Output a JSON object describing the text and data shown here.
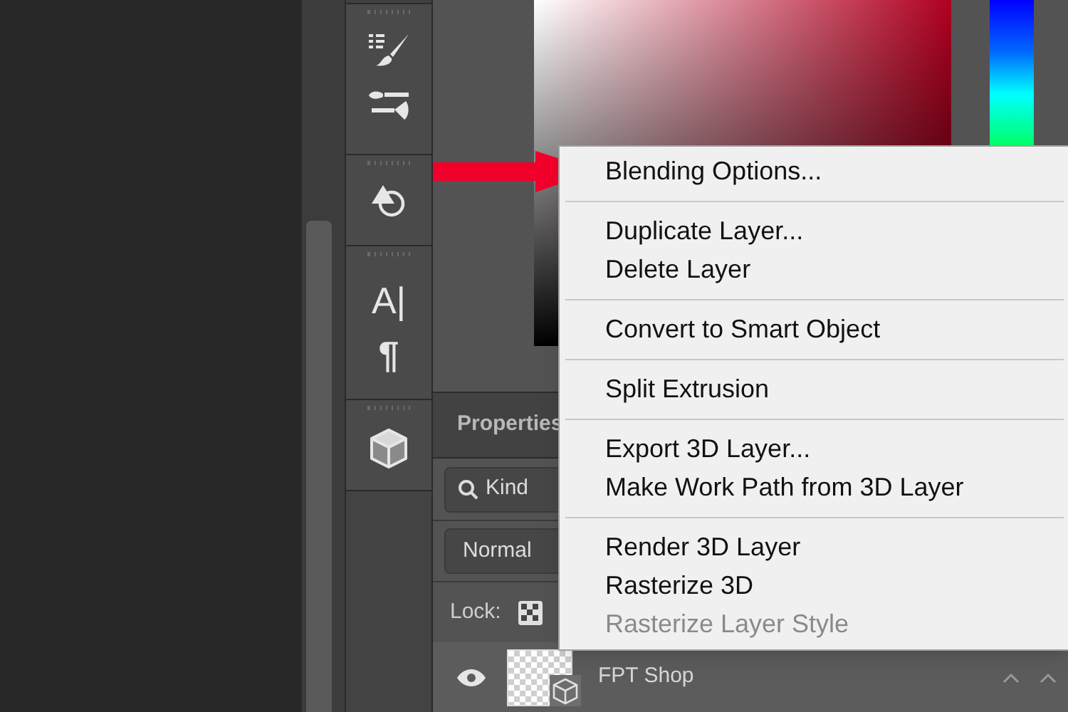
{
  "toolbar": {
    "glyphs": [
      "A|",
      "¶"
    ]
  },
  "properties_panel": {
    "tab": "Properties",
    "filter": {
      "value": "Kind"
    },
    "blend_mode": {
      "value": "Normal"
    },
    "lock_label": "Lock:"
  },
  "layer": {
    "name": "FPT Shop",
    "visible": true
  },
  "context_menu": {
    "groups": [
      {
        "items": [
          {
            "label": "Blending Options...",
            "disabled": false
          }
        ]
      },
      {
        "items": [
          {
            "label": "Duplicate Layer...",
            "disabled": false
          },
          {
            "label": "Delete Layer",
            "disabled": false
          }
        ]
      },
      {
        "items": [
          {
            "label": "Convert to Smart Object",
            "disabled": false
          }
        ]
      },
      {
        "items": [
          {
            "label": "Split Extrusion",
            "disabled": false
          }
        ]
      },
      {
        "items": [
          {
            "label": "Export 3D Layer...",
            "disabled": false
          },
          {
            "label": "Make Work Path from 3D Layer",
            "disabled": false
          }
        ]
      },
      {
        "items": [
          {
            "label": "Render 3D Layer",
            "disabled": false
          },
          {
            "label": "Rasterize 3D",
            "disabled": false
          },
          {
            "label": "Rasterize Layer Style",
            "disabled": true
          }
        ]
      }
    ]
  }
}
